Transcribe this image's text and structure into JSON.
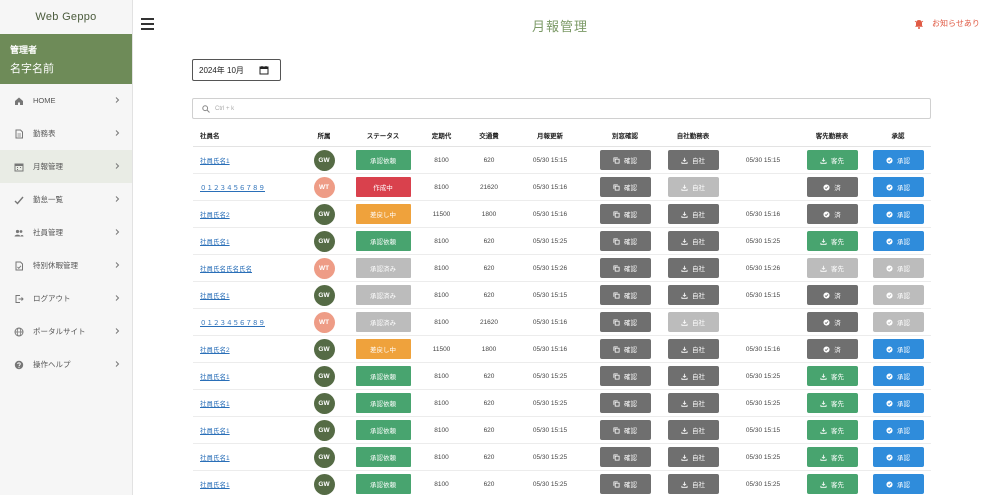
{
  "brand": "Web Geppo",
  "user": {
    "role": "管理者",
    "name": "名字名前"
  },
  "nav": [
    {
      "label": "HOME",
      "icon": "home-icon"
    },
    {
      "label": "勤務表",
      "icon": "document-icon"
    },
    {
      "label": "月報管理",
      "icon": "calendar-icon",
      "active": true
    },
    {
      "label": "勤怠一覧",
      "icon": "check-icon"
    },
    {
      "label": "社員管理",
      "icon": "people-icon"
    },
    {
      "label": "特別休暇管理",
      "icon": "leave-document-icon"
    },
    {
      "label": "ログアウト",
      "icon": "logout-icon"
    },
    {
      "label": "ポータルサイト",
      "icon": "globe-icon"
    },
    {
      "label": "操作ヘルプ",
      "icon": "help-icon"
    }
  ],
  "header": {
    "title": "月報管理",
    "notice": "お知らせあり"
  },
  "month": {
    "value": "2024年 10月"
  },
  "search": {
    "placeholder": "Ctrl + k"
  },
  "columns": [
    "社員名",
    "所属",
    "ステータス",
    "定期代",
    "交通費",
    "月報更新",
    "別窓確認",
    "自社勤務表",
    "",
    "客先勤務表",
    "承認"
  ],
  "colors": {
    "green": "#48a46f",
    "red": "#d9414d",
    "orange": "#efa23c",
    "gray": "#bcbcbc",
    "dark": "#6f6f6f",
    "blue": "#2f8cdb",
    "avatar_gw": "#556b45",
    "avatar_wt": "#ee9c86"
  },
  "labels": {
    "check": "確認",
    "own": "自社",
    "client": "客先",
    "done": "済",
    "approve": "承認"
  },
  "rows": [
    {
      "name": "社員氏名1",
      "aff": "GW",
      "status": "承認依頼",
      "status_color": "green",
      "fare": "8100",
      "transit": "620",
      "updated": "05/30 15:15",
      "own_enabled": true,
      "own_date": "05/30 15:15",
      "client": "download",
      "approve_enabled": true
    },
    {
      "name": "０１２３４５６７８９",
      "aff": "WT",
      "status": "作成中",
      "status_color": "red",
      "fare": "8100",
      "transit": "21620",
      "updated": "05/30 15:16",
      "own_enabled": false,
      "own_date": "",
      "client": "done",
      "approve_enabled": true
    },
    {
      "name": "社員氏名2",
      "aff": "GW",
      "status": "差戻し中",
      "status_color": "orange",
      "fare": "11500",
      "transit": "1800",
      "updated": "05/30 15:16",
      "own_enabled": true,
      "own_date": "05/30 15:16",
      "client": "done",
      "approve_enabled": true
    },
    {
      "name": "社員氏名1",
      "aff": "GW",
      "status": "承認依頼",
      "status_color": "green",
      "fare": "8100",
      "transit": "620",
      "updated": "05/30 15:25",
      "own_enabled": true,
      "own_date": "05/30 15:25",
      "client": "download",
      "approve_enabled": true
    },
    {
      "name": "社員氏名氏名氏名",
      "aff": "WT",
      "status": "承認済み",
      "status_color": "gray",
      "fare": "8100",
      "transit": "620",
      "updated": "05/30 15:26",
      "own_enabled": true,
      "own_date": "05/30 15:26",
      "client": "download-disabled",
      "approve_enabled": false
    },
    {
      "name": "社員氏名1",
      "aff": "GW",
      "status": "承認済み",
      "status_color": "gray",
      "fare": "8100",
      "transit": "620",
      "updated": "05/30 15:15",
      "own_enabled": true,
      "own_date": "05/30 15:15",
      "client": "done",
      "approve_enabled": false
    },
    {
      "name": "０１２３４５６７８９",
      "aff": "WT",
      "status": "承認済み",
      "status_color": "gray",
      "fare": "8100",
      "transit": "21620",
      "updated": "05/30 15:16",
      "own_enabled": false,
      "own_date": "",
      "client": "done",
      "approve_enabled": false
    },
    {
      "name": "社員氏名2",
      "aff": "GW",
      "status": "差戻し中",
      "status_color": "orange",
      "fare": "11500",
      "transit": "1800",
      "updated": "05/30 15:16",
      "own_enabled": true,
      "own_date": "05/30 15:16",
      "client": "done",
      "approve_enabled": true
    },
    {
      "name": "社員氏名1",
      "aff": "GW",
      "status": "承認依頼",
      "status_color": "green",
      "fare": "8100",
      "transit": "620",
      "updated": "05/30 15:25",
      "own_enabled": true,
      "own_date": "05/30 15:25",
      "client": "download",
      "approve_enabled": true
    },
    {
      "name": "社員氏名1",
      "aff": "GW",
      "status": "承認依頼",
      "status_color": "green",
      "fare": "8100",
      "transit": "620",
      "updated": "05/30 15:25",
      "own_enabled": true,
      "own_date": "05/30 15:25",
      "client": "download",
      "approve_enabled": true
    },
    {
      "name": "社員氏名1",
      "aff": "GW",
      "status": "承認依頼",
      "status_color": "green",
      "fare": "8100",
      "transit": "620",
      "updated": "05/30 15:15",
      "own_enabled": true,
      "own_date": "05/30 15:15",
      "client": "download",
      "approve_enabled": true
    },
    {
      "name": "社員氏名1",
      "aff": "GW",
      "status": "承認依頼",
      "status_color": "green",
      "fare": "8100",
      "transit": "620",
      "updated": "05/30 15:25",
      "own_enabled": true,
      "own_date": "05/30 15:25",
      "client": "download",
      "approve_enabled": true
    },
    {
      "name": "社員氏名1",
      "aff": "GW",
      "status": "承認依頼",
      "status_color": "green",
      "fare": "8100",
      "transit": "620",
      "updated": "05/30 15:25",
      "own_enabled": true,
      "own_date": "05/30 15:25",
      "client": "download",
      "approve_enabled": true
    }
  ]
}
